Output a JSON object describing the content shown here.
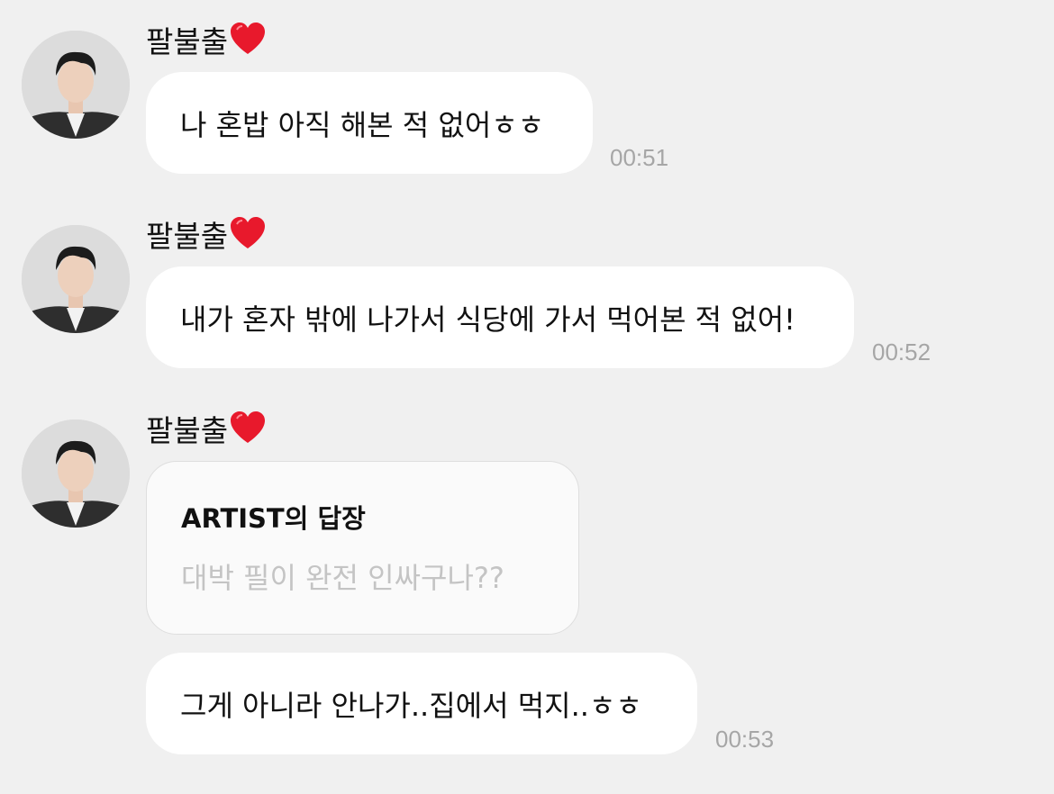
{
  "messages": [
    {
      "sender": "팔불출",
      "text": "나 혼밥 아직 해본 적 없어ㅎㅎ",
      "time": "00:51"
    },
    {
      "sender": "팔불출",
      "text": "내가 혼자 밖에 나가서 식당에 가서 먹어본 적 없어!",
      "time": "00:52"
    },
    {
      "sender": "팔불출",
      "reply": {
        "title": "ARTIST의 답장",
        "quoted_text": "대박 필이 완전 인싸구나??"
      },
      "text": "그게 아니라 안나가..집에서 먹지..ㅎㅎ",
      "time": "00:53"
    }
  ],
  "icons": {
    "heart": "heart-icon",
    "avatar": "avatar"
  },
  "colors": {
    "background": "#f0f0f0",
    "bubble": "#ffffff",
    "heart": "#e8192c",
    "timestamp": "#a6a6a6",
    "quoted_text": "#c4c4c4"
  }
}
